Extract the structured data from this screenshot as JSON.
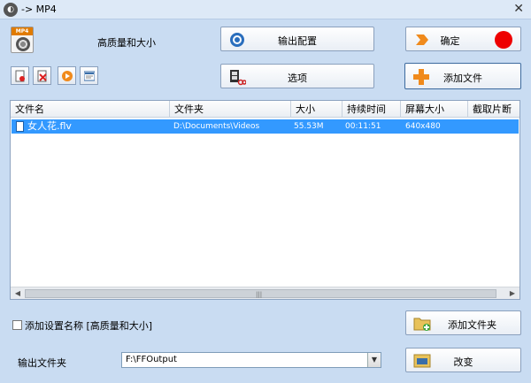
{
  "window": {
    "title": "-> MP4",
    "close_glyph": "✕"
  },
  "preset": {
    "label": "高质量和大小",
    "icon": "mp4-film-icon",
    "icon_tag": "MP4"
  },
  "buttons": {
    "output_config": "输出配置",
    "options": "选项",
    "ok": "确定",
    "add_file": "添加文件",
    "add_folder": "添加文件夹",
    "change": "改变"
  },
  "small_buttons": [
    "remove-file-icon",
    "clear-list-icon",
    "play-icon",
    "media-info-icon"
  ],
  "columns": [
    "文件名",
    "文件夹",
    "大小",
    "持续时间",
    "屏幕大小",
    "截取片断"
  ],
  "rows": [
    {
      "name": "女人花.flv",
      "folder": "D:\\Documents\\Videos",
      "size": "55.53M",
      "duration": "00:11:51",
      "resolution": "640x480",
      "clip": ""
    }
  ],
  "add_setting_name": {
    "label": "添加设置名称 [高质量和大小]",
    "checked": false
  },
  "output_folder": {
    "label": "输出文件夹",
    "value": "F:\\FFOutput"
  },
  "colors": {
    "selection": "#3399ff",
    "record_dot": "#ee0000",
    "background": "#c9dcf2"
  }
}
